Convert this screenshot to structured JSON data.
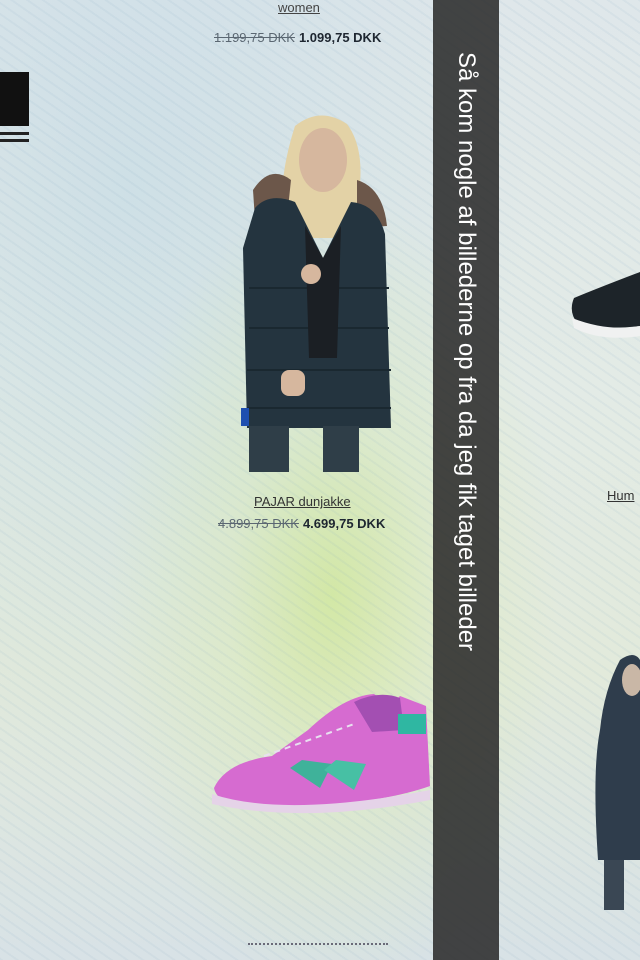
{
  "top_product": {
    "category_link": "women",
    "price_old": "1.199,75 DKK",
    "price_new": "1.099,75 DKK"
  },
  "jacket_product": {
    "name": "PAJAR dunjakke",
    "price_old": "4.899,75 DKK",
    "price_new": "4.699,75 DKK"
  },
  "right_product": {
    "name_partial": "Hum"
  },
  "caption": {
    "text": "Så kom nogle af billederne op fra da jeg fik taget billeder"
  },
  "icons": [
    "jacket-photo",
    "sneaker-photo",
    "dark-shoe-photo",
    "stacked-product-icon",
    "partial-jacket-photo"
  ]
}
